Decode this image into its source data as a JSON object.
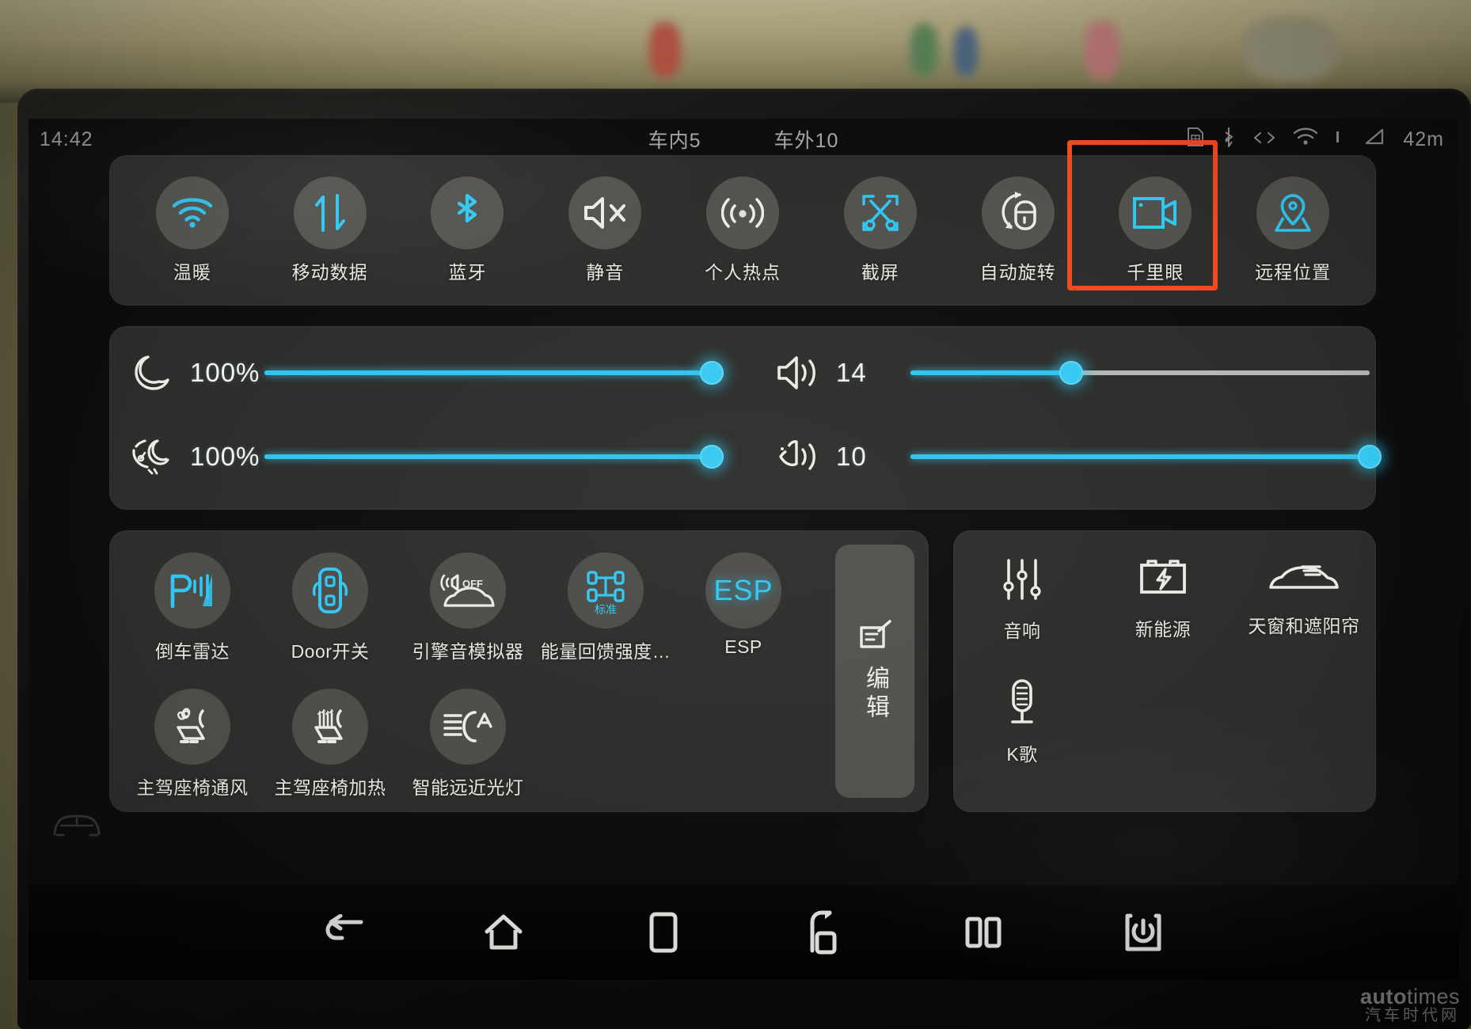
{
  "status_bar": {
    "time": "14:42",
    "cabin_temp_label": "车内5",
    "outside_temp_label": "车外10",
    "distance": "42m",
    "icons": [
      "sim-card-icon",
      "bluetooth-icon",
      "data-transfer-icon",
      "wifi-icon",
      "signal-bar-icon",
      "range-triangle-icon"
    ]
  },
  "quick_settings": {
    "items": [
      {
        "label": "温暖",
        "icon": "wifi-icon",
        "active": true
      },
      {
        "label": "移动数据",
        "icon": "mobile-data-icon",
        "active": true
      },
      {
        "label": "蓝牙",
        "icon": "bluetooth-icon",
        "active": true
      },
      {
        "label": "静音",
        "icon": "mute-icon",
        "active": false
      },
      {
        "label": "个人热点",
        "icon": "hotspot-icon",
        "active": false
      },
      {
        "label": "截屏",
        "icon": "screenshot-icon",
        "active": true
      },
      {
        "label": "自动旋转",
        "icon": "auto-rotate-icon",
        "active": false
      },
      {
        "label": "千里眼",
        "icon": "remote-camera-icon",
        "active": true,
        "highlighted": true
      },
      {
        "label": "远程位置",
        "icon": "location-pin-icon",
        "active": true
      }
    ],
    "highlight_color": "#f04a20"
  },
  "sliders": [
    {
      "name": "screen-brightness",
      "icon": "moon-icon",
      "value": "100%",
      "percent": 100
    },
    {
      "name": "cluster-brightness",
      "icon": "dashboard-moon-icon",
      "value": "100%",
      "percent": 100
    },
    {
      "name": "media-volume",
      "icon": "speaker-icon",
      "value": "14",
      "percent": 35
    },
    {
      "name": "voice-volume",
      "icon": "voice-icon",
      "value": "10",
      "percent": 100
    }
  ],
  "shortcuts": {
    "rows": [
      [
        {
          "label": "倒车雷达",
          "icon": "parking-radar-icon",
          "active": true
        },
        {
          "label": "Door开关",
          "icon": "door-control-icon",
          "active": true
        },
        {
          "label": "引擎音模拟器",
          "icon": "engine-sound-icon",
          "active": false,
          "badge": "OFF"
        },
        {
          "label": "能量回馈强度…",
          "icon": "regen-braking-icon",
          "active": true,
          "sub": "标准"
        },
        {
          "label": "ESP",
          "icon": "esp-icon",
          "active": true
        }
      ],
      [
        {
          "label": "主驾座椅通风",
          "icon": "seat-ventilation-icon",
          "active": false
        },
        {
          "label": "主驾座椅加热",
          "icon": "seat-heating-icon",
          "active": false
        },
        {
          "label": "智能远近光灯",
          "icon": "auto-highbeam-icon",
          "active": false
        }
      ]
    ],
    "edit_button": {
      "label": "编辑",
      "icon": "edit-icon"
    }
  },
  "right_panel": {
    "items": [
      {
        "label": "音响",
        "icon": "equalizer-icon"
      },
      {
        "label": "新能源",
        "icon": "ev-battery-icon"
      },
      {
        "label": "天窗和遮阳帘",
        "icon": "sunroof-icon"
      },
      {
        "label": "K歌",
        "icon": "microphone-icon"
      }
    ]
  },
  "nav_bar": {
    "buttons": [
      {
        "name": "back-icon"
      },
      {
        "name": "home-icon"
      },
      {
        "name": "recents-icon"
      },
      {
        "name": "app-switch-icon"
      },
      {
        "name": "split-screen-icon"
      },
      {
        "name": "power-icon"
      }
    ]
  },
  "watermark": {
    "main": "autotimes",
    "main_bold": "auto",
    "main_light": "times",
    "sub": "汽车时代网"
  },
  "theme": {
    "accent": "#2fc8f3",
    "panel_bg": "rgba(118,120,112,0.30)",
    "text": "#e7e9e4",
    "highlight": "#f04a20"
  }
}
